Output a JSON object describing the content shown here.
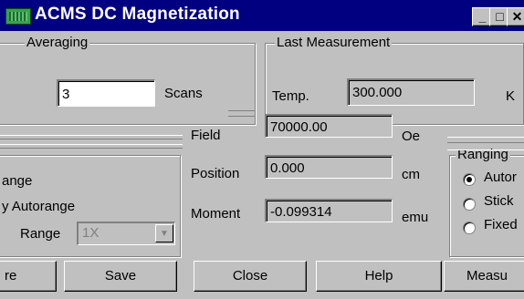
{
  "window": {
    "title": "ACMS DC Magnetization",
    "icon": "app-icon",
    "controls": {
      "minimize": "_",
      "maximize": "□",
      "close": "✕"
    }
  },
  "averaging": {
    "legend": "Averaging",
    "scans_value": "3",
    "scans_label": "Scans"
  },
  "last_measurement": {
    "legend": "Last Measurement",
    "temp_label": "Temp.",
    "temp_value": "300.000",
    "temp_unit": "K",
    "field_label": "Field",
    "field_value": "70000.00",
    "field_unit": "Oe",
    "position_label": "Position",
    "position_value": "0.000",
    "position_unit": "cm",
    "moment_label": "Moment",
    "moment_value": "-0.099314",
    "moment_unit": "emu"
  },
  "range_group": {
    "option1": "ange",
    "option2": "y Autorange",
    "range_label": "Range",
    "range_value": "1X"
  },
  "ranging": {
    "legend": "Ranging",
    "options": [
      "Autor",
      "Stick",
      "Fixed"
    ],
    "selected_index": 0
  },
  "buttons": {
    "left_partial": "re",
    "save": "Save",
    "close": "Close",
    "help": "Help",
    "measure": "Measu"
  }
}
